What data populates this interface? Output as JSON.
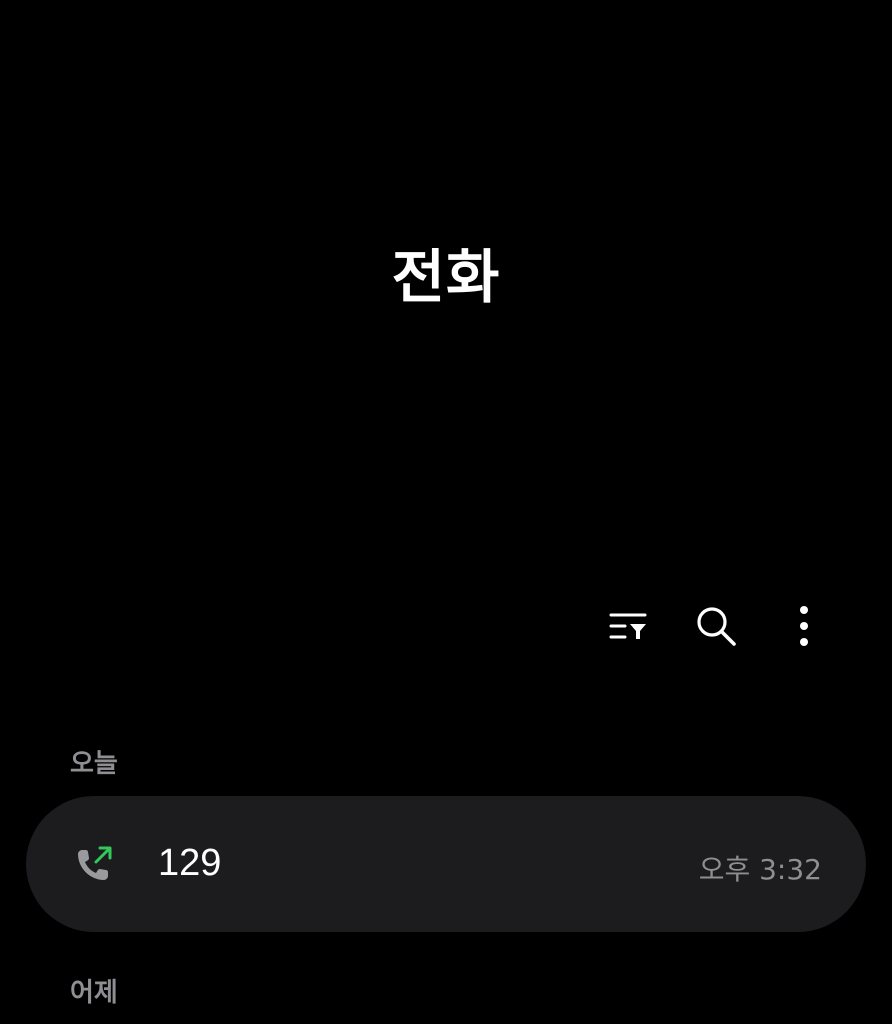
{
  "header": {
    "title": "전화"
  },
  "toolbar": {
    "items": [
      {
        "icon": "filter-list-icon"
      },
      {
        "icon": "search-icon"
      },
      {
        "icon": "more-vertical-icon"
      }
    ]
  },
  "call_log": {
    "sections": [
      {
        "label": "오늘",
        "items": [
          {
            "icon": "outgoing-call-icon",
            "number": "129",
            "time": "오후 3:32"
          }
        ]
      },
      {
        "label": "어제",
        "items": []
      }
    ]
  },
  "colors": {
    "background": "#000000",
    "card": "#1c1c1e",
    "secondary_text": "#8e8e93",
    "outgoing_arrow": "#34c759"
  }
}
